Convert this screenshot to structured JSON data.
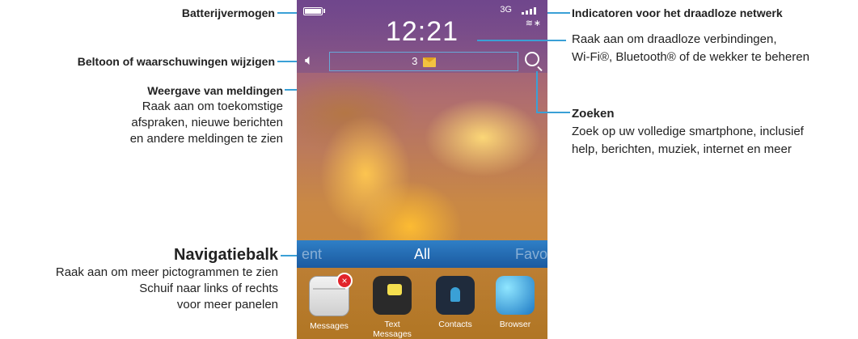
{
  "phone": {
    "clock": "12:21",
    "network": "3G",
    "notification_count": "3",
    "nav_left": "ent",
    "nav_center": "All",
    "nav_right": "Favo",
    "apps": [
      {
        "label": "Messages"
      },
      {
        "label": "Text Messages"
      },
      {
        "label": "Contacts"
      },
      {
        "label": "Browser"
      }
    ]
  },
  "annotations": {
    "battery": "Batterijvermogen",
    "ringtone": "Beltoon of waarschuwingen wijzigen",
    "notifications_title": "Weergave van meldingen",
    "notifications_lines": [
      "Raak aan om toekomstige",
      "afspraken, nieuwe berichten",
      "en andere meldingen te zien"
    ],
    "nav_title": "Navigatiebalk",
    "nav_lines": [
      "Raak aan om meer pictogrammen te zien",
      "Schuif naar links of rechts",
      "voor meer panelen"
    ],
    "wireless_title": "Indicatoren voor het draadloze netwerk",
    "wireless_lines": [
      "Raak aan om draadloze verbindingen,",
      "Wi-Fi®, Bluetooth® of de wekker te beheren"
    ],
    "search_title": "Zoeken",
    "search_lines": [
      "Zoek op uw volledige smartphone, inclusief",
      "help, berichten, muziek, internet en meer"
    ]
  },
  "colors": {
    "callout_line": "#3aa0d6",
    "nav_bar": "#2f7fc6"
  }
}
